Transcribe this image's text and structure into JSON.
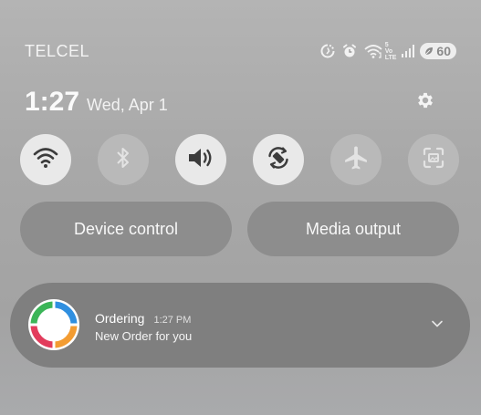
{
  "status_bar": {
    "carrier": "TELCEL",
    "icons": [
      "data-saver-icon",
      "alarm-icon",
      "wifi-calling-icon",
      "signal-icon",
      "battery-saver-icon"
    ],
    "network_top": "5",
    "network_mid": "Vo",
    "network_bottom": "LTE",
    "battery_level": "60"
  },
  "header": {
    "time": "1:27",
    "date": "Wed, Apr 1",
    "settings_icon": "gear-icon"
  },
  "quick_toggles": [
    {
      "icon": "wifi-icon",
      "state": "on"
    },
    {
      "icon": "bluetooth-icon",
      "state": "off"
    },
    {
      "icon": "sound-icon",
      "state": "on"
    },
    {
      "icon": "auto-rotate-icon",
      "state": "on"
    },
    {
      "icon": "airplane-mode-icon",
      "state": "off"
    },
    {
      "icon": "screenshot-icon",
      "state": "off"
    }
  ],
  "buttons": {
    "device_control": "Device control",
    "media_output": "Media output"
  },
  "notification": {
    "app_icon": "ordering-app-icon",
    "title": "Ordering",
    "time": "1:27 PM",
    "body": "New Order for you",
    "expand_icon": "chevron-down-icon"
  },
  "colors": {
    "tile_on": "#e9e9e9",
    "tile_off": "#b9b9b9",
    "icon_on": "#3c3c3c",
    "icon_off": "#e3e3e3",
    "app_icon_ring": [
      "#2f8fe0",
      "#f39c32",
      "#e23c5c",
      "#3bb558"
    ]
  }
}
